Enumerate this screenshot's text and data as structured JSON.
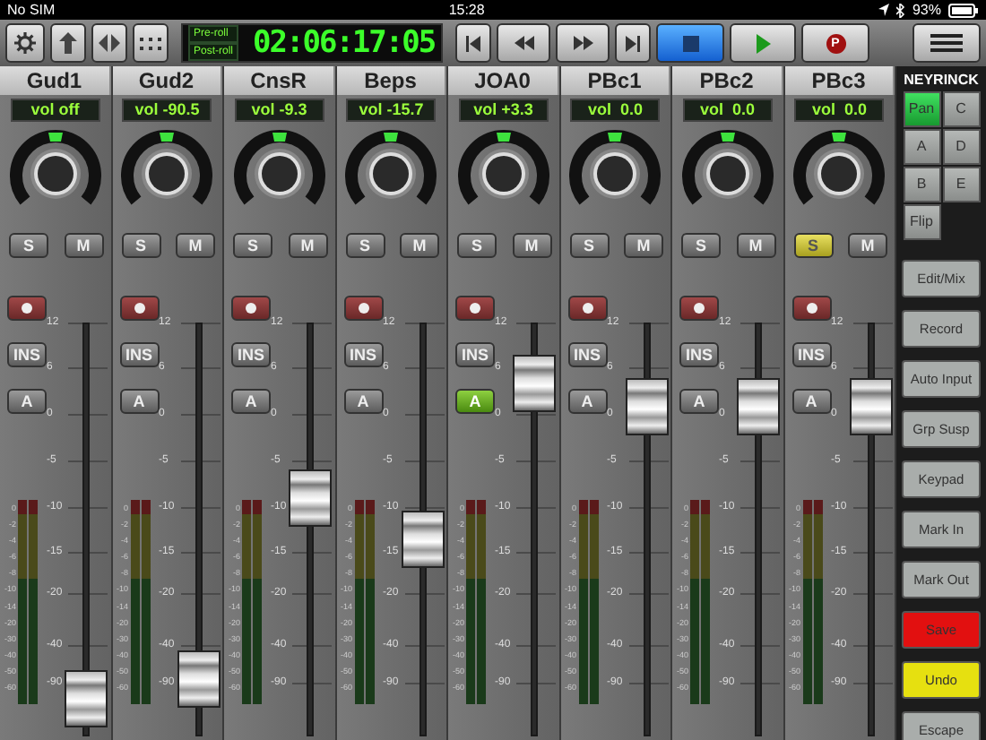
{
  "status_bar": {
    "carrier": "No SIM",
    "time": "15:28",
    "battery": "93%"
  },
  "toolbar": {
    "left_buttons": [
      {
        "kind": "settings"
      },
      {
        "kind": "up"
      },
      {
        "kind": "leftright"
      },
      {
        "kind": "grid"
      }
    ],
    "counter": {
      "pre_roll": "Pre-roll",
      "post_roll": "Post-roll",
      "timecode": "02:06:17:05"
    },
    "transport": [
      {
        "kind": "start",
        "selected": false
      },
      {
        "kind": "rewind",
        "selected": false
      },
      {
        "kind": "forward",
        "selected": false
      },
      {
        "kind": "end",
        "selected": false
      },
      {
        "kind": "stop",
        "selected": true
      },
      {
        "kind": "play",
        "selected": false
      },
      {
        "kind": "record",
        "label": "P",
        "selected": false
      }
    ]
  },
  "channels": [
    {
      "name": "Gud1",
      "volume": "vol off",
      "solo_label": "S",
      "solo": false,
      "mute_label": "M",
      "mute": false,
      "inserts_label": "INS",
      "auto_label": "A",
      "auto": false,
      "level": 0.01,
      "fader_scale": [
        "12",
        "6",
        "0",
        "-5",
        "-10",
        "-15",
        "-20",
        "-40",
        "-90"
      ],
      "meter_scale": [
        "0",
        "-2",
        "-4",
        "-6",
        "-8",
        "-10",
        "-14",
        "-20",
        "-30",
        "-40",
        "-50",
        "-60"
      ]
    },
    {
      "name": "Gud2",
      "volume": "vol -90.5",
      "solo_label": "S",
      "solo": false,
      "mute_label": "M",
      "mute": false,
      "inserts_label": "INS",
      "auto_label": "A",
      "auto": false,
      "level": 0.06,
      "fader_scale": [
        "12",
        "6",
        "0",
        "-5",
        "-10",
        "-15",
        "-20",
        "-40",
        "-90"
      ],
      "meter_scale": [
        "0",
        "-2",
        "-4",
        "-6",
        "-8",
        "-10",
        "-14",
        "-20",
        "-30",
        "-40",
        "-50",
        "-60"
      ]
    },
    {
      "name": "CnsR",
      "volume": "vol -9.3",
      "solo_label": "S",
      "solo": false,
      "mute_label": "M",
      "mute": false,
      "inserts_label": "INS",
      "auto_label": "A",
      "auto": false,
      "level": 0.54,
      "fader_scale": [
        "12",
        "6",
        "0",
        "-5",
        "-10",
        "-15",
        "-20",
        "-40",
        "-90"
      ],
      "meter_scale": [
        "0",
        "-2",
        "-4",
        "-6",
        "-8",
        "-10",
        "-14",
        "-20",
        "-30",
        "-40",
        "-50",
        "-60"
      ]
    },
    {
      "name": "Beps",
      "volume": "vol -15.7",
      "solo_label": "S",
      "solo": false,
      "mute_label": "M",
      "mute": false,
      "inserts_label": "INS",
      "auto_label": "A",
      "auto": false,
      "level": 0.43,
      "fader_scale": [
        "12",
        "6",
        "0",
        "-5",
        "-10",
        "-15",
        "-20",
        "-40",
        "-90"
      ],
      "meter_scale": [
        "0",
        "-2",
        "-4",
        "-6",
        "-8",
        "-10",
        "-14",
        "-20",
        "-30",
        "-40",
        "-50",
        "-60"
      ]
    },
    {
      "name": "JOA0",
      "volume": "vol +3.3",
      "solo_label": "S",
      "solo": false,
      "mute_label": "M",
      "mute": false,
      "inserts_label": "INS",
      "auto_label": "A",
      "auto": true,
      "level": 0.84,
      "fader_scale": [
        "12",
        "6",
        "0",
        "-5",
        "-10",
        "-15",
        "-20",
        "-40",
        "-90"
      ],
      "meter_scale": [
        "0",
        "-2",
        "-4",
        "-6",
        "-8",
        "-10",
        "-14",
        "-20",
        "-30",
        "-40",
        "-50",
        "-60"
      ]
    },
    {
      "name": "PBc1",
      "volume": "vol  0.0",
      "solo_label": "S",
      "solo": false,
      "mute_label": "M",
      "mute": false,
      "inserts_label": "INS",
      "auto_label": "A",
      "auto": false,
      "level": 0.78,
      "fader_scale": [
        "12",
        "6",
        "0",
        "-5",
        "-10",
        "-15",
        "-20",
        "-40",
        "-90"
      ],
      "meter_scale": [
        "0",
        "-2",
        "-4",
        "-6",
        "-8",
        "-10",
        "-14",
        "-20",
        "-30",
        "-40",
        "-50",
        "-60"
      ]
    },
    {
      "name": "PBc2",
      "volume": "vol  0.0",
      "solo_label": "S",
      "solo": false,
      "mute_label": "M",
      "mute": false,
      "inserts_label": "INS",
      "auto_label": "A",
      "auto": false,
      "level": 0.78,
      "fader_scale": [
        "12",
        "6",
        "0",
        "-5",
        "-10",
        "-15",
        "-20",
        "-40",
        "-90"
      ],
      "meter_scale": [
        "0",
        "-2",
        "-4",
        "-6",
        "-8",
        "-10",
        "-14",
        "-20",
        "-30",
        "-40",
        "-50",
        "-60"
      ]
    },
    {
      "name": "PBc3",
      "volume": "vol  0.0",
      "solo_label": "S",
      "solo": true,
      "mute_label": "M",
      "mute": false,
      "inserts_label": "INS",
      "auto_label": "A",
      "auto": false,
      "level": 0.78,
      "fader_scale": [
        "12",
        "6",
        "0",
        "-5",
        "-10",
        "-15",
        "-20",
        "-40",
        "-90"
      ],
      "meter_scale": [
        "0",
        "-2",
        "-4",
        "-6",
        "-8",
        "-10",
        "-14",
        "-20",
        "-30",
        "-40",
        "-50",
        "-60"
      ]
    }
  ],
  "right_panel": {
    "brand": "NEYRINCK",
    "modes": [
      {
        "label": "Pan",
        "selected": true
      },
      {
        "label": "C",
        "selected": false
      },
      {
        "label": "A",
        "selected": false
      },
      {
        "label": "D",
        "selected": false
      },
      {
        "label": "B",
        "selected": false
      },
      {
        "label": "E",
        "selected": false
      },
      {
        "label": "Flip",
        "selected": false
      }
    ],
    "buttons": [
      {
        "label": "Edit/Mix",
        "color": "#a9adab"
      },
      {
        "label": "Record",
        "color": "#a9adab"
      },
      {
        "label": "Auto Input",
        "color": "#a9adab"
      },
      {
        "label": "Grp Susp",
        "color": "#a9adab"
      },
      {
        "label": "Keypad",
        "color": "#a9adab"
      },
      {
        "label": "Mark In",
        "color": "#a9adab"
      },
      {
        "label": "Mark Out",
        "color": "#a9adab"
      },
      {
        "label": "Save",
        "color": "#e21010"
      },
      {
        "label": "Undo",
        "color": "#e6e010"
      },
      {
        "label": "Escape",
        "color": "#a9adab"
      }
    ]
  }
}
